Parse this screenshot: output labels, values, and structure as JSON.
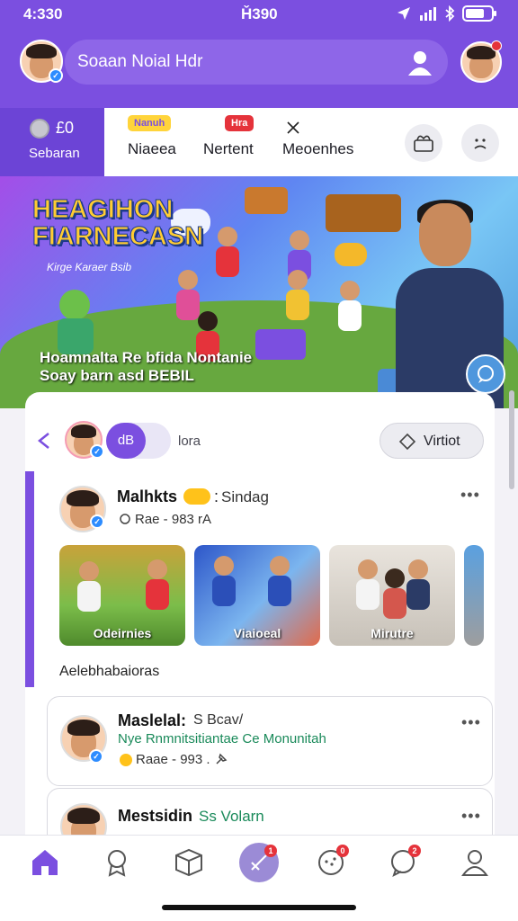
{
  "status_bar": {
    "time": "4:330",
    "center": "Ȟ390",
    "icons": [
      "location-icon",
      "signal-icon",
      "bluetooth-icon",
      "battery-icon"
    ]
  },
  "header": {
    "search_text": "Soaan Noial Hdr"
  },
  "balance": {
    "amount": "£0",
    "label": "Sebaran"
  },
  "tabs": [
    {
      "label": "Niaeea",
      "badge": "Nanuh"
    },
    {
      "label": "Nertent",
      "badge": "Hra"
    },
    {
      "label": "Meoenhes"
    }
  ],
  "banner": {
    "title": "HEAGIHON FIARNECASN",
    "subtitle": "Kirge Karaer Bsib",
    "caption_line1": "Hoamnalta Re bfida Nontanie",
    "caption_line2": "Soay barn asd BEBIL"
  },
  "stories": {
    "pill_label": "dB",
    "label": "lora",
    "button_label": "Virtiot"
  },
  "post1": {
    "name": "Malhkts",
    "tag": "Sindag",
    "meta": "Rae - 983 rA"
  },
  "thumbnails": [
    {
      "caption": "Odeirnies"
    },
    {
      "caption": "Viaioeal"
    },
    {
      "caption": "Mirutre"
    }
  ],
  "section": {
    "title": "Aelebhabaioras"
  },
  "post2": {
    "name": "Maslelal:",
    "handle": "S Bcav/",
    "subtitle": "Nye Rnmnitsitiantae Ce Monunitah",
    "meta": "Raae - 993 ."
  },
  "post3": {
    "name": "Mestsidin",
    "tag": "Ss Volarn"
  },
  "bottom_nav": {
    "items": [
      "home-icon",
      "badge-icon",
      "box-icon",
      "compose-icon",
      "chat-bubbles-icon",
      "chat-icon",
      "profile-icon"
    ],
    "badges": {
      "compose": "1",
      "chat_bubbles": "0",
      "chat": "2"
    }
  },
  "colors": {
    "accent": "#7b4fe0",
    "badge": "#e5333b",
    "verified": "#2d8cff",
    "subtitle": "#1a8a5a"
  }
}
